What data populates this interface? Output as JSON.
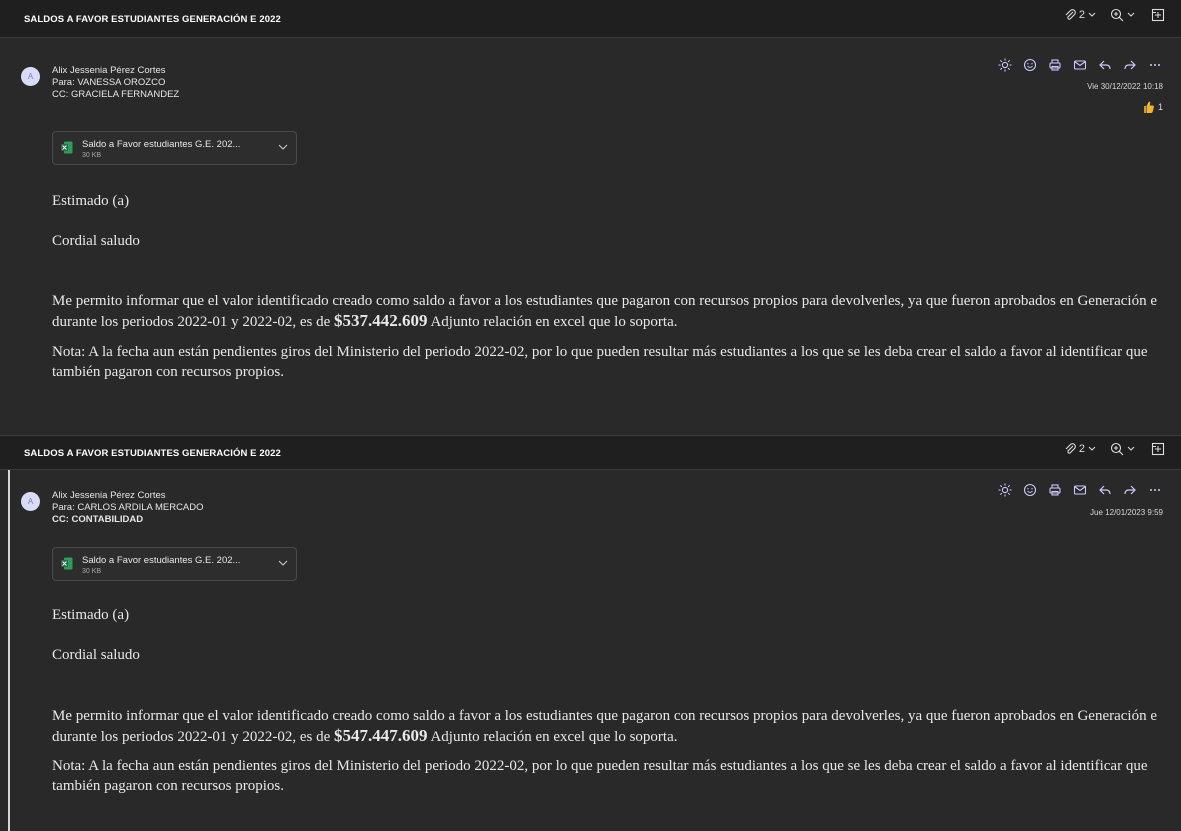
{
  "threads": [
    {
      "subject": "SALDOS A FAVOR ESTUDIANTES GENERACIÓN E 2022",
      "attachment_count": "2",
      "avatar_initial": "A",
      "sender": "Alix Jessenia Pérez Cortes",
      "to": "Para: VANESSA OROZCO",
      "cc": "CC: GRACIELA FERNANDEZ",
      "date": "Vie 30/12/2022 10:18",
      "reaction_count": "1",
      "attachment": {
        "name": "Saldo a Favor estudiantes G.E. 202...",
        "size": "30 KB"
      },
      "greeting": "Estimado (a)",
      "salutation": "Cordial saludo",
      "paragraph1_before": "Me permito informar que el valor identificado creado como saldo a favor a los estudiantes que pagaron con recursos propios para devolverles, ya que fueron aprobados en Generación e durante los periodos 2022-01 y 2022-02, es de ",
      "amount": "$537.442.609",
      "paragraph1_after": " Adjunto relación en excel que lo soporta.",
      "note": "Nota: A la fecha aun están pendientes giros del Ministerio del periodo 2022-02, por lo que pueden resultar más estudiantes a los que se les deba crear el saldo a favor al identificar que también pagaron con recursos propios."
    },
    {
      "subject": "SALDOS A FAVOR ESTUDIANTES GENERACIÓN E 2022",
      "attachment_count": "2",
      "avatar_initial": "A",
      "sender": "Alix Jessenia Pérez Cortes",
      "to": "Para: CARLOS ARDILA MERCADO",
      "cc": "CC: CONTABILIDAD",
      "date": "Jue 12/01/2023 9:59",
      "attachment": {
        "name": "Saldo a Favor estudiantes G.E. 202...",
        "size": "30 KB"
      },
      "greeting": "Estimado (a)",
      "salutation": "Cordial saludo",
      "paragraph1_before": "Me permito informar que el valor identificado creado como saldo a favor a los estudiantes que pagaron con recursos propios para devolverles, ya que fueron aprobados en Generación e durante los periodos 2022-01 y 2022-02, es de ",
      "amount": "$547.447.609",
      "paragraph1_after": " Adjunto relación en excel que lo soporta.",
      "note": "Nota: A la fecha aun están pendientes giros del Ministerio del periodo 2022-02, por lo que pueden resultar más estudiantes a los que se les deba crear el saldo a favor al identificar que también pagaron con recursos propios."
    }
  ],
  "icons": {
    "attach": "paperclip-icon",
    "zoom": "zoom-in-icon",
    "popout": "open-in-window-icon",
    "brightness": "sun-icon",
    "emoji": "smiley-icon",
    "print": "printer-icon",
    "mark": "envelope-icon",
    "reply": "reply-icon",
    "forward": "forward-icon",
    "more": "more-icon",
    "reaction": "thumbs-up-icon",
    "excel": "excel-file-icon"
  },
  "colors": {
    "background": "#292929",
    "bar": "#1f1f1f",
    "excel": "#1d7044",
    "reaction": "#f2b530"
  }
}
